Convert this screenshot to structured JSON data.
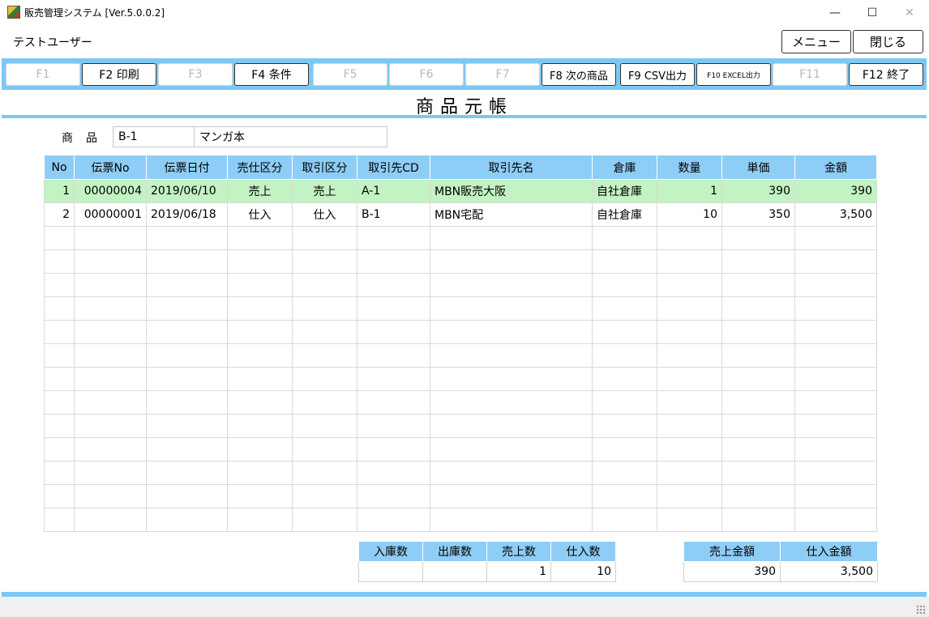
{
  "window": {
    "title": "販売管理システム [Ver.5.0.0.2]",
    "controls": {
      "minimize": "—",
      "maximize": "☐",
      "close": "✕"
    }
  },
  "user": {
    "name": "テストユーザー"
  },
  "top_buttons": {
    "menu": "メニュー",
    "close": "閉じる"
  },
  "fkeys": [
    {
      "label": "F1",
      "enabled": false
    },
    {
      "label": "F2 印刷",
      "enabled": true
    },
    {
      "label": "F3",
      "enabled": false
    },
    {
      "label": "F4 条件",
      "enabled": true
    },
    {
      "label": "F5",
      "enabled": false
    },
    {
      "label": "F6",
      "enabled": false
    },
    {
      "label": "F7",
      "enabled": false
    },
    {
      "label": "F8 次の商品",
      "enabled": true
    },
    {
      "label": "F9 CSV出力",
      "enabled": true
    },
    {
      "label": "F10 EXCEL出力",
      "enabled": true
    },
    {
      "label": "F11",
      "enabled": false
    },
    {
      "label": "F12 終了",
      "enabled": true
    }
  ],
  "page_title": "商品元帳",
  "product": {
    "label": "商品",
    "code": "B-1",
    "name": "マンガ本"
  },
  "table": {
    "columns": [
      "No",
      "伝票No",
      "伝票日付",
      "売仕区分",
      "取引区分",
      "取引先CD",
      "取引先名",
      "倉庫",
      "数量",
      "単価",
      "金額"
    ],
    "rows": [
      [
        "1",
        "00000004",
        "2019/06/10",
        "売上",
        "売上",
        "A-1",
        "MBN販売大阪",
        "自社倉庫",
        "1",
        "390",
        "390"
      ],
      [
        "2",
        "00000001",
        "2019/06/18",
        "仕入",
        "仕入",
        "B-1",
        "MBN宅配",
        "自社倉庫",
        "10",
        "350",
        "3,500"
      ]
    ],
    "selected_row": 0,
    "empty_rows": 13
  },
  "quantity_summary": {
    "headers": [
      "入庫数",
      "出庫数",
      "売上数",
      "仕入数"
    ],
    "values": [
      "",
      "",
      "1",
      "10"
    ]
  },
  "amount_summary": {
    "headers": [
      "売上金額",
      "仕入金額"
    ],
    "values": [
      "390",
      "3,500"
    ]
  },
  "colors": {
    "accent": "#7cc8f4",
    "header": "#8ecdf6",
    "selected_row": "#c3f2c3"
  }
}
